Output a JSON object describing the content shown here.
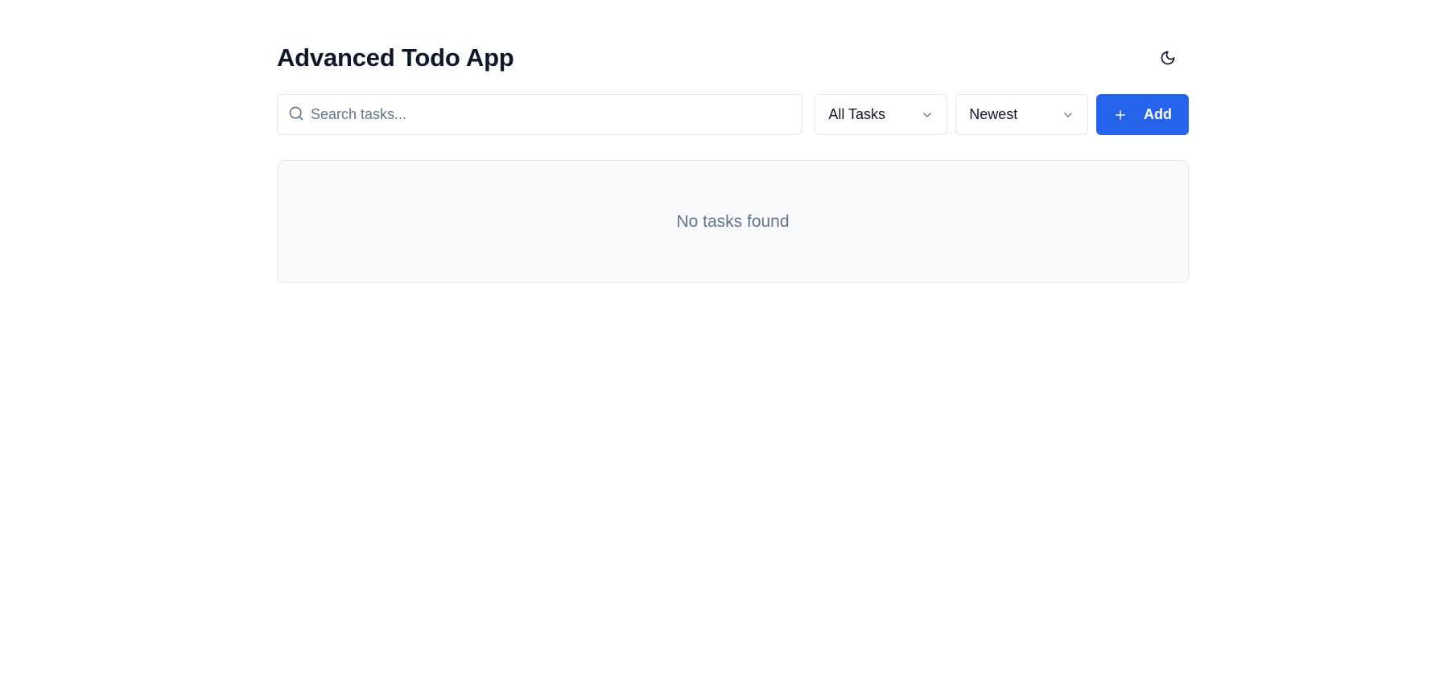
{
  "app": {
    "title": "Advanced Todo App",
    "theme_toggle_icon": "moon-icon"
  },
  "toolbar": {
    "search": {
      "placeholder": "Search tasks...",
      "value": "",
      "icon": "search-icon"
    },
    "filter_select": {
      "selected": "All Tasks",
      "icon": "chevron-down-icon"
    },
    "sort_select": {
      "selected": "Newest",
      "icon": "chevron-down-icon"
    },
    "add_button": {
      "label": "Add",
      "icon": "plus-icon"
    }
  },
  "task_list": {
    "empty_message": "No tasks found"
  },
  "colors": {
    "accent": "#2563eb",
    "text": "#0f172a",
    "muted": "#64748b",
    "border": "#e2e8f0",
    "panel_bg": "#f8fafc"
  }
}
